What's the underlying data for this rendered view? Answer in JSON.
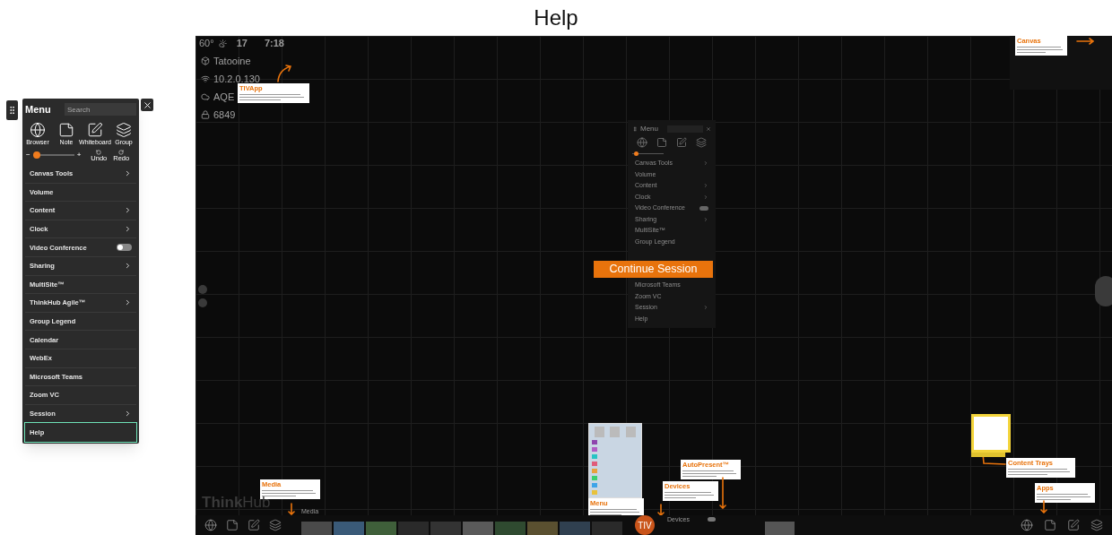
{
  "title": "Help",
  "menu": {
    "title": "Menu",
    "search_placeholder": "Search",
    "undo": "Undo",
    "redo": "Redo",
    "zoom": {
      "minus": "−",
      "plus": "+",
      "level": 0.1
    },
    "tools": [
      {
        "kind": "browser",
        "label": "Browser"
      },
      {
        "kind": "note",
        "label": "Note"
      },
      {
        "kind": "whiteboard",
        "label": "Whiteboard"
      },
      {
        "kind": "group",
        "label": "Group"
      }
    ],
    "items": [
      {
        "label": "Canvas Tools",
        "kind": "submenu",
        "selected": false
      },
      {
        "label": "Volume",
        "kind": "plain",
        "selected": false
      },
      {
        "label": "Content",
        "kind": "submenu",
        "selected": false
      },
      {
        "label": "Clock",
        "kind": "submenu",
        "selected": false
      },
      {
        "label": "Video Conference",
        "kind": "toggle",
        "on": false,
        "selected": false
      },
      {
        "label": "Sharing",
        "kind": "submenu",
        "selected": false
      },
      {
        "label": "MultiSite™",
        "kind": "plain",
        "selected": false
      },
      {
        "label": "ThinkHub Agile™",
        "kind": "submenu",
        "selected": false
      },
      {
        "label": "Group Legend",
        "kind": "plain",
        "selected": false
      },
      {
        "label": "Calendar",
        "kind": "plain",
        "selected": false
      },
      {
        "label": "WebEx",
        "kind": "plain",
        "selected": false
      },
      {
        "label": "Microsoft Teams",
        "kind": "plain",
        "selected": false
      },
      {
        "label": "Zoom VC",
        "kind": "plain",
        "selected": false
      },
      {
        "label": "Session",
        "kind": "submenu",
        "selected": false
      },
      {
        "label": "Help",
        "kind": "plain",
        "selected": true
      }
    ]
  },
  "canvas": {
    "status": {
      "temperature": "60°",
      "day": "17",
      "time": "7:18"
    },
    "info": [
      {
        "kind": "location",
        "text": "Tatooine"
      },
      {
        "kind": "wifi",
        "text": "10.2.0.130"
      },
      {
        "kind": "cloud",
        "text": "AQE"
      },
      {
        "kind": "lock",
        "text": "6849"
      }
    ],
    "background_menu": {
      "title": "Menu",
      "zoom": {
        "level": 0.05
      },
      "tools": [
        {
          "kind": "browser"
        },
        {
          "kind": "note"
        },
        {
          "kind": "whiteboard"
        },
        {
          "kind": "group"
        }
      ],
      "items": [
        {
          "label": "Canvas Tools",
          "kind": "submenu"
        },
        {
          "label": "Volume",
          "kind": "plain"
        },
        {
          "label": "Content",
          "kind": "submenu"
        },
        {
          "label": "Clock",
          "kind": "submenu"
        },
        {
          "label": "Video Conference",
          "kind": "toggle",
          "on": false
        },
        {
          "label": "Sharing",
          "kind": "submenu"
        },
        {
          "label": "MultiSite™",
          "kind": "plain"
        },
        {
          "label": "Group Legend",
          "kind": "plain"
        },
        {
          "label": "Microsoft Teams",
          "kind": "plain"
        },
        {
          "label": "Zoom VC",
          "kind": "plain"
        },
        {
          "label": "Session",
          "kind": "submenu"
        },
        {
          "label": "Help",
          "kind": "plain"
        }
      ]
    },
    "continue_button": "Continue Session",
    "callouts": [
      {
        "kind": "tivapp",
        "title": "TIVApp"
      },
      {
        "kind": "canvas",
        "title": "Canvas"
      },
      {
        "kind": "media",
        "title": "Media"
      },
      {
        "kind": "menu",
        "title": "Menu"
      },
      {
        "kind": "autopresent",
        "title": "AutoPresent™"
      },
      {
        "kind": "devices",
        "title": "Devices"
      },
      {
        "kind": "trays",
        "title": "Content Trays"
      },
      {
        "kind": "apps",
        "title": "Apps"
      }
    ],
    "logo": {
      "bold": "Think",
      "light": "Hub"
    },
    "tray": {
      "media_label": "Media",
      "devices_label": "Devices",
      "devices_toggle": {
        "on": false
      },
      "tiv": "TIV",
      "left_apps": [
        {
          "kind": "browser"
        },
        {
          "kind": "note"
        },
        {
          "kind": "whiteboard"
        },
        {
          "kind": "group"
        }
      ],
      "right_apps": [
        {
          "kind": "browser"
        },
        {
          "kind": "note"
        },
        {
          "kind": "whiteboard"
        },
        {
          "kind": "group"
        }
      ]
    }
  }
}
